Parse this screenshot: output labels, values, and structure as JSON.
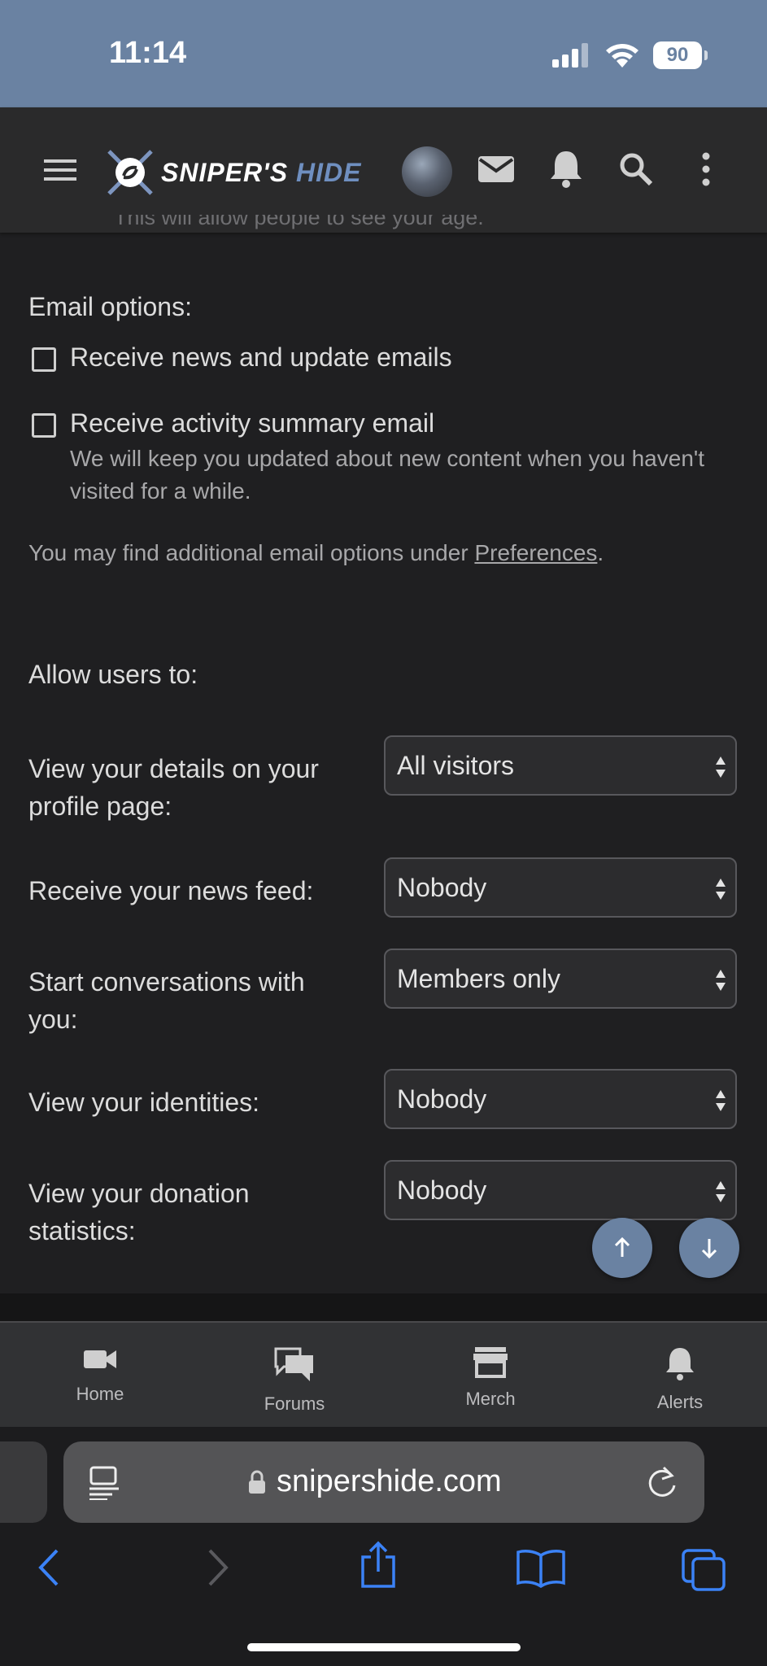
{
  "status_bar": {
    "time": "11:14",
    "battery": "90"
  },
  "header": {
    "logo_main": "SNIPER'S",
    "logo_accent": "HIDE",
    "icons": [
      "menu-icon",
      "mail-icon",
      "bell-icon",
      "search-icon",
      "more-vertical-icon"
    ]
  },
  "faded_text": "This will allow people to see your age.",
  "email_options": {
    "heading": "Email options:",
    "news_label": "Receive news and update emails",
    "summary_label": "Receive activity summary email",
    "summary_hint": "We will keep you updated about new content when you haven't visited for a while.",
    "note_prefix": "You may find additional email options under ",
    "note_link": "Preferences",
    "note_suffix": "."
  },
  "privacy": {
    "heading": "Allow users to:",
    "rows": [
      {
        "label": "View your details on your profile page:",
        "value": "All visitors"
      },
      {
        "label": "Receive your news feed:",
        "value": "Nobody"
      },
      {
        "label": "Start conversations with you:",
        "value": "Members only"
      },
      {
        "label": "View your identities:",
        "value": "Nobody"
      },
      {
        "label": "View your donation statistics:",
        "value": "Nobody"
      }
    ]
  },
  "tabbar": {
    "items": [
      {
        "label": "Home",
        "icon": "video-camera-icon"
      },
      {
        "label": "Forums",
        "icon": "chat-bubbles-icon"
      },
      {
        "label": "Merch",
        "icon": "store-icon"
      },
      {
        "label": "Alerts",
        "icon": "bell-icon"
      }
    ]
  },
  "browser": {
    "url": "snipershide.com"
  },
  "colors": {
    "accent": "#6a82a2",
    "background": "#1f1f21",
    "link_blue": "#3b82f6"
  }
}
